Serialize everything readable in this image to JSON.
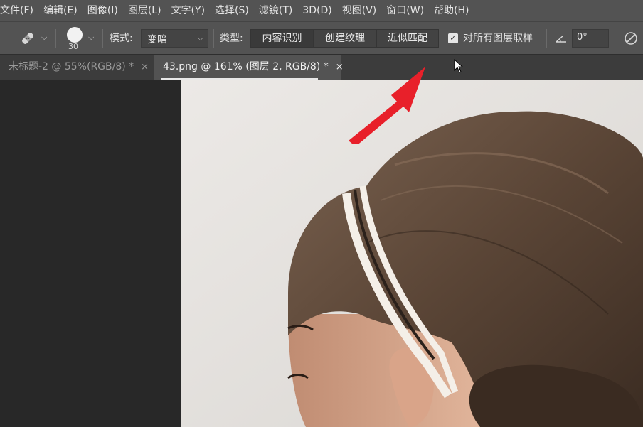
{
  "menu": [
    "文件(F)",
    "编辑(E)",
    "图像(I)",
    "图层(L)",
    "文字(Y)",
    "选择(S)",
    "滤镜(T)",
    "3D(D)",
    "视图(V)",
    "窗口(W)",
    "帮助(H)"
  ],
  "options": {
    "brush_size": "30",
    "mode_label": "模式:",
    "mode_value": "变暗",
    "type_label": "类型:",
    "type_buttons": [
      "内容识别",
      "创建纹理",
      "近似匹配"
    ],
    "sample_all_layers_label": "对所有图层取样",
    "sample_all_layers_checked": true,
    "angle_value": "0°"
  },
  "tabs": [
    {
      "label": "未标题-2 @ 55%(RGB/8) *",
      "active": false
    },
    {
      "label": "43.png @ 161% (图层 2, RGB/8) *",
      "active": true
    }
  ],
  "tab_close_glyph": "×",
  "colors": {
    "annotation_arrow": "#e8202a",
    "hair": "#5a4536",
    "headband": "#f4efe8"
  },
  "icons": {
    "tool": "spot-healing-brush-icon",
    "brush_preset": "brush-circle-icon",
    "angle": "angle-icon",
    "pressure": "pressure-icon",
    "cursor": "mouse-pointer-icon"
  }
}
